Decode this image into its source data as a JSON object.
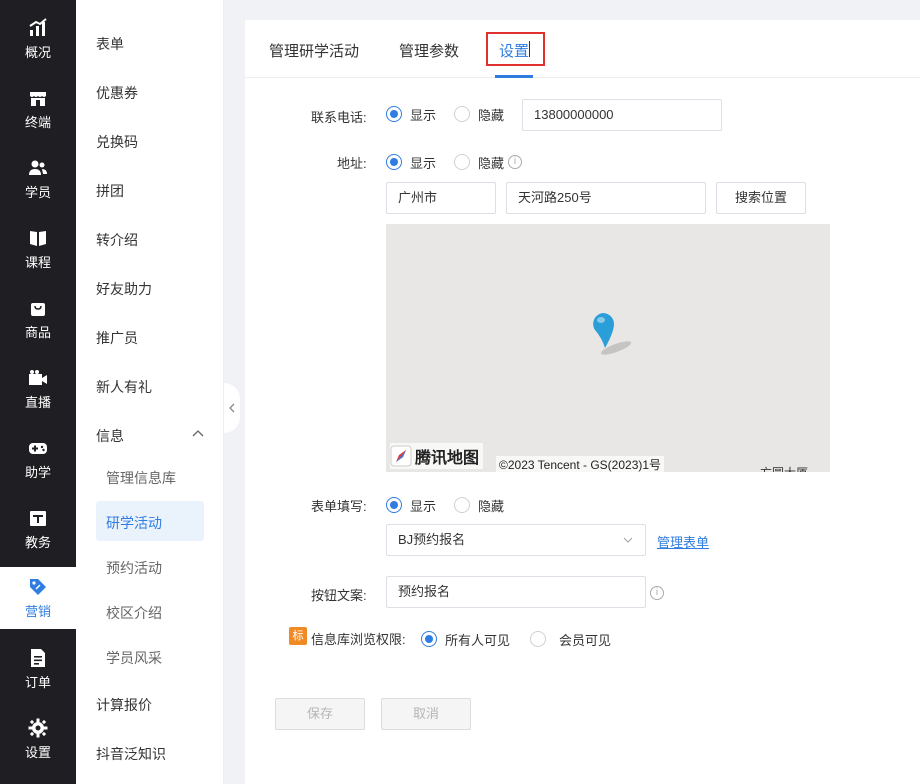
{
  "left_nav": [
    {
      "label": "概况",
      "icon": "chart-icon"
    },
    {
      "label": "终端",
      "icon": "store-icon"
    },
    {
      "label": "学员",
      "icon": "users-icon"
    },
    {
      "label": "课程",
      "icon": "book-icon"
    },
    {
      "label": "商品",
      "icon": "bag-icon"
    },
    {
      "label": "直播",
      "icon": "video-icon"
    },
    {
      "label": "助学",
      "icon": "gamepad-icon"
    },
    {
      "label": "教务",
      "icon": "calendar-icon"
    },
    {
      "label": "营销",
      "icon": "tag-icon"
    },
    {
      "label": "订单",
      "icon": "order-icon"
    },
    {
      "label": "设置",
      "icon": "gear-icon"
    }
  ],
  "submenu": {
    "items": [
      "表单",
      "优惠券",
      "兑换码",
      "拼团",
      "转介绍",
      "好友助力",
      "推广员",
      "新人有礼",
      "信息"
    ],
    "sub_items": [
      "管理信息库",
      "研学活动",
      "预约活动",
      "校区介绍",
      "学员风采"
    ],
    "bottom_items": [
      "计算报价",
      "抖音泛知识"
    ]
  },
  "tabs": [
    "管理研学活动",
    "管理参数",
    "设置"
  ],
  "form": {
    "phone": {
      "label": "联系电话:",
      "show": "显示",
      "hide": "隐藏",
      "value": "13800000000"
    },
    "address": {
      "label": "地址:",
      "show": "显示",
      "hide": "隐藏",
      "city": "广州市",
      "street": "天河路250号",
      "search_button": "搜索位置"
    },
    "map": {
      "logo_text": "腾讯地图",
      "copyright": "©2023 Tencent - GS(2023)1号",
      "place_label": "方圆大厦"
    },
    "form_fill": {
      "label": "表单填写:",
      "show": "显示",
      "hide": "隐藏",
      "selected": "BJ预约报名",
      "manage_link": "管理表单"
    },
    "button_text": {
      "label": "按钮文案:",
      "value": "预约报名"
    },
    "permission": {
      "badge": "标",
      "label": "信息库浏览权限:",
      "option_all": "所有人可见",
      "option_member": "会员可见"
    }
  },
  "actions": {
    "save": "保存",
    "cancel": "取消"
  },
  "colors": {
    "accent": "#2f7de1",
    "nav_bg": "#1f1f23",
    "highlight_border": "#e03131",
    "badge": "#f08a24"
  }
}
